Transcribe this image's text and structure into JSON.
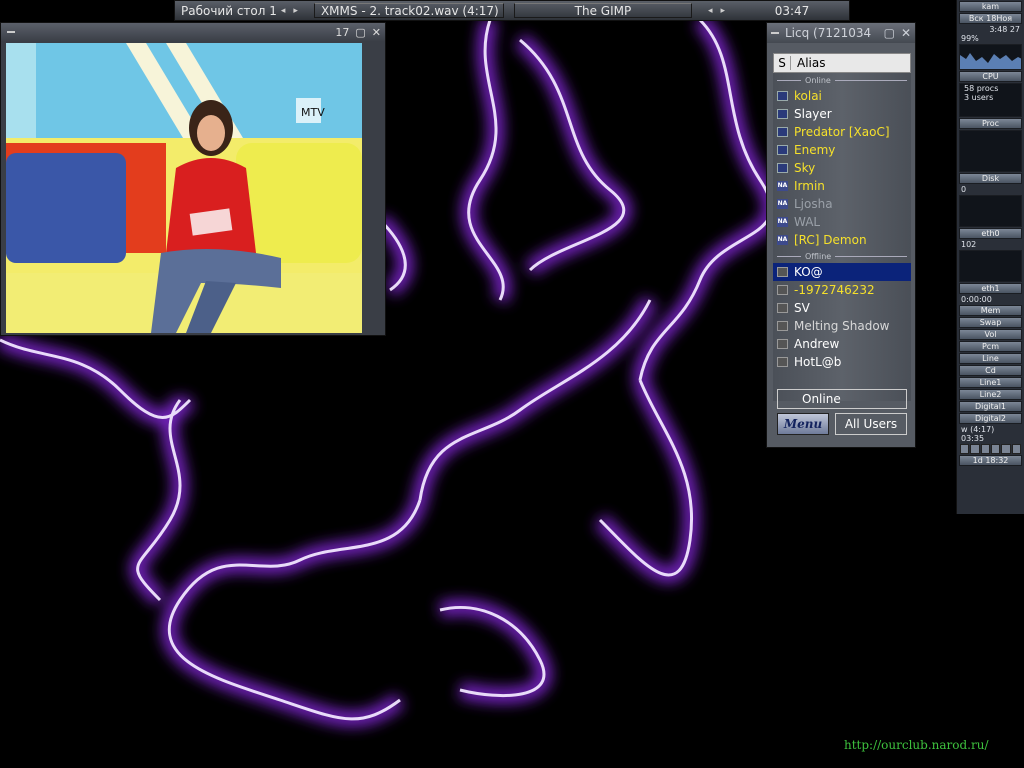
{
  "taskbar": {
    "desktop": "Рабочий стол 1",
    "tasks": [
      "XMMS - 2. track02.wav (4:17)",
      "The GIMP"
    ],
    "clock": "03:47"
  },
  "tv": {
    "number": "17",
    "channel": "MTV"
  },
  "licq": {
    "title": "Licq (7121034",
    "col_s": "S",
    "col_alias": "Alias",
    "group_online": "Online",
    "group_offline": "Offline",
    "online": [
      {
        "name": "kolai",
        "color": "#f5e02b",
        "icon": "monitor"
      },
      {
        "name": "Slayer",
        "color": "#ffffff",
        "icon": "monitor"
      },
      {
        "name": "Predator [XaoC]",
        "color": "#f5e02b",
        "icon": "monitor"
      },
      {
        "name": "Enemy",
        "color": "#f5e02b",
        "icon": "monitor"
      },
      {
        "name": "Sky",
        "color": "#f5e02b",
        "icon": "away"
      },
      {
        "name": "Irmin",
        "color": "#f5e02b",
        "icon": "na"
      },
      {
        "name": "Ljosha",
        "color": "#9aa0a8",
        "icon": "na"
      },
      {
        "name": "WAL",
        "color": "#9aa0a8",
        "icon": "na"
      },
      {
        "name": "[RC] Demon",
        "color": "#f5e02b",
        "icon": "na"
      }
    ],
    "offline": [
      {
        "name": "KO@",
        "color": "#ffffff",
        "selected": true
      },
      {
        "name": "-1972746232",
        "color": "#f5e02b"
      },
      {
        "name": "SV",
        "color": "#ffffff"
      },
      {
        "name": "Melting Shadow",
        "color": "#d8d8d8"
      },
      {
        "name": "Andrew",
        "color": "#ffffff"
      },
      {
        "name": "HotL@b",
        "color": "#ffffff"
      }
    ],
    "status": "Online",
    "menu": "Menu",
    "all_users": "All Users"
  },
  "dock": {
    "host": "kam",
    "date": "Вск 18Ноя",
    "time": "3:48 27",
    "cpu_pct": "99%",
    "cpu_label": "CPU",
    "procs": "58 procs",
    "users": "3 users",
    "proc_label": "Proc",
    "disk_label": "Disk",
    "disk_val": "0",
    "eth0_label": "eth0",
    "eth0_val": "102",
    "eth1_label": "eth1",
    "uptime": "0:00:00",
    "mem_label": "Mem",
    "swap_label": "Swap",
    "vol_label": "Vol",
    "pcm_label": "Pcm",
    "line_label": "Line",
    "cd_label": "Cd",
    "line1_label": "Line1",
    "line2_label": "Line2",
    "digital1_label": "Digital1",
    "digital2_label": "Digital2",
    "xmms_track": "w (4:17)",
    "xmms_time": "03:35",
    "bottom_text": "1d 18:32"
  },
  "url": "http://ourclub.narod.ru/"
}
